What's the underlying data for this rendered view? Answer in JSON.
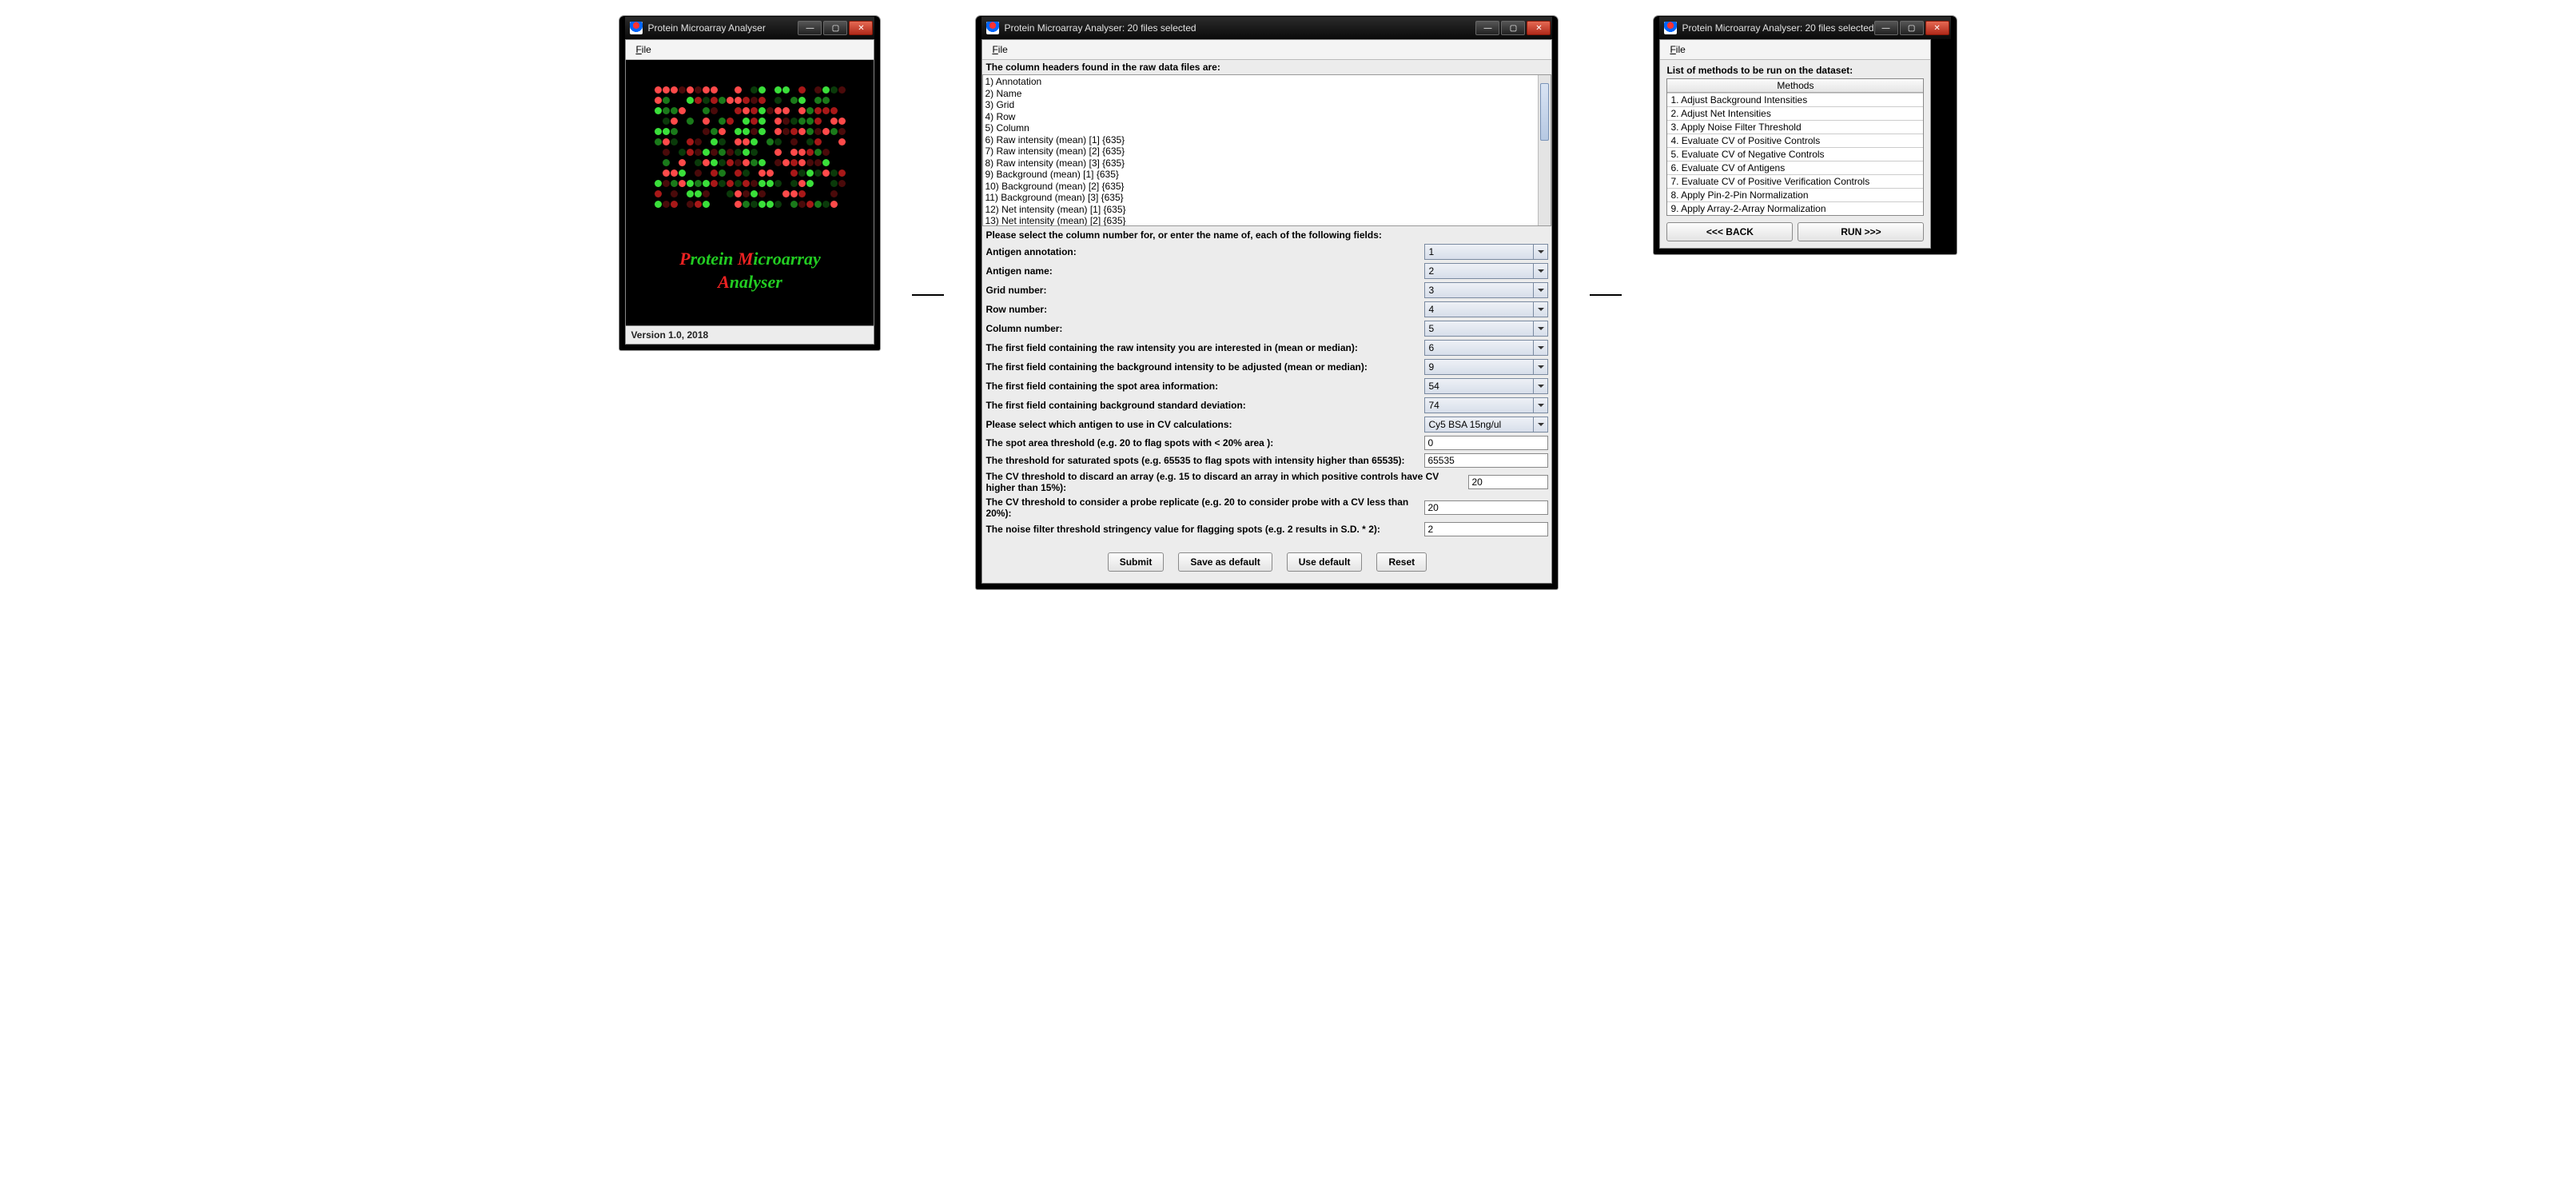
{
  "window1": {
    "title": "Protein Microarray Analyser",
    "file_menu": "File",
    "splash_title_html": [
      "P",
      "rotein ",
      "M",
      "icroarray ",
      "A",
      "nalyser"
    ],
    "version": "Version 1.0, 2018"
  },
  "window2": {
    "title": "Protein Microarray Analyser: 20 files selected",
    "file_menu": "File",
    "headers_label": "The column headers found in the raw data files are:",
    "headers": [
      "1) Annotation",
      "2) Name",
      "3) Grid",
      "4) Row",
      "5) Column",
      "6) Raw intensity (mean) [1] {635}",
      "7) Raw intensity (mean) [2] {635}",
      "8) Raw intensity (mean) [3] {635}",
      "9) Background (mean) [1] {635}",
      "10) Background (mean) [2] {635}",
      "11) Background (mean) [3] {635}",
      "12) Net intensity (mean) [1] {635}",
      "13) Net intensity (mean) [2] {635}"
    ],
    "select_label": "Please select the column number for, or enter the name of, each of the following fields:",
    "fields": [
      {
        "label": "Antigen annotation:",
        "value": "1",
        "type": "combo"
      },
      {
        "label": "Antigen name:",
        "value": "2",
        "type": "combo"
      },
      {
        "label": "Grid number:",
        "value": "3",
        "type": "combo"
      },
      {
        "label": "Row number:",
        "value": "4",
        "type": "combo"
      },
      {
        "label": "Column number:",
        "value": "5",
        "type": "combo"
      },
      {
        "label": "The first field containing the raw intensity you are interested in (mean or median):",
        "value": "6",
        "type": "combo"
      },
      {
        "label": "The first field containing the background intensity to be adjusted (mean or median):",
        "value": "9",
        "type": "combo"
      },
      {
        "label": "The first field containing the spot area information:",
        "value": "54",
        "type": "combo"
      },
      {
        "label": "The first field containing background standard deviation:",
        "value": "74",
        "type": "combo"
      },
      {
        "label": "Please select which antigen to use in CV calculations:",
        "value": "Cy5 BSA 15ng/ul",
        "type": "combo"
      },
      {
        "label": "The spot area threshold (e.g. 20 to flag spots with < 20% area ):",
        "value": "0",
        "type": "text"
      },
      {
        "label": "The threshold for saturated spots (e.g. 65535 to flag spots with intensity higher than 65535):",
        "value": "65535",
        "type": "text"
      },
      {
        "label": "The CV threshold to discard an array (e.g. 15 to discard an array in which positive controls have CV higher than 15%):",
        "value": "20",
        "type": "text",
        "narrow": true
      },
      {
        "label": "The CV threshold to consider a probe replicate (e.g. 20 to consider probe with a CV less than 20%):",
        "value": "20",
        "type": "text"
      },
      {
        "label": "The noise filter threshold stringency value for flagging spots (e.g. 2 results in S.D. * 2):",
        "value": "2",
        "type": "text"
      }
    ],
    "buttons": {
      "submit": "Submit",
      "save_default": "Save as default",
      "use_default": "Use default",
      "reset": "Reset"
    }
  },
  "window3": {
    "title": "Protein Microarray Analyser: 20 files selected",
    "file_menu": "File",
    "methods_label": "List of methods to be run on the dataset:",
    "methods_header": "Methods",
    "methods": [
      "1. Adjust Background Intensities",
      "2. Adjust Net Intensities",
      "3. Apply Noise Filter Threshold",
      "4. Evaluate CV of Positive Controls",
      "5. Evaluate CV of Negative Controls",
      "6. Evaluate CV of Antigens",
      "7. Evaluate CV of Positive Verification Controls",
      "8. Apply Pin-2-Pin Normalization",
      "9. Apply Array-2-Array Normalization"
    ],
    "back_btn": "<<< BACK",
    "run_btn": "RUN >>>"
  },
  "chrome": {
    "min": "—",
    "max": "▢",
    "close": "✕"
  }
}
